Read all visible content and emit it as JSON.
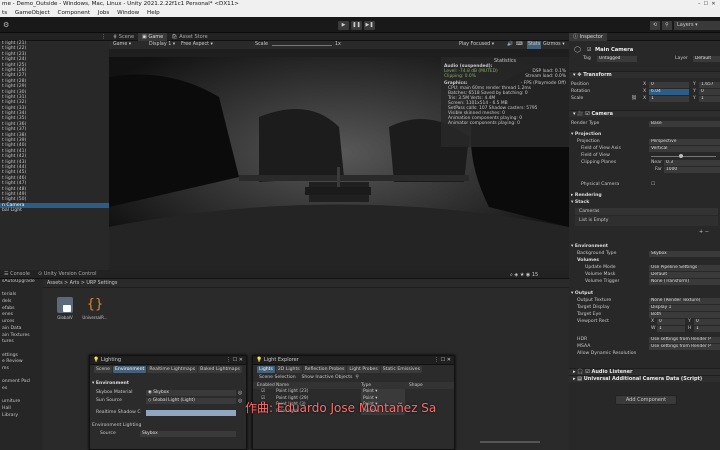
{
  "window": {
    "title": "me - Demo_Outside - Windows, Mac, Linux - Unity 2021.2.22f1c1 Personal* <DX11>"
  },
  "menu": [
    "ts",
    "GameObject",
    "Component",
    "Jobs",
    "Window",
    "Help"
  ],
  "toolbar": {
    "layers": "Layers"
  },
  "hierarchy": {
    "items": [
      "t light (21)",
      "t light (22)",
      "t light (23)",
      "t light (24)",
      "t light (25)",
      "t light (26)",
      "t light (27)",
      "t light (28)",
      "t light (29)",
      "t light (30)",
      "t light (31)",
      "t light (32)",
      "t light (33)",
      "t light (34)",
      "t light (35)",
      "t light (36)",
      "t light (37)",
      "t light (38)",
      "t light (39)",
      "t light (40)",
      "t light (41)",
      "t light (42)",
      "t light (43)",
      "t light (44)",
      "t light (45)",
      "t light (46)",
      "t light (47)",
      "t light (48)",
      "t light (49)",
      "t light (50)",
      "n Camera",
      "bal Light"
    ],
    "selected_index": 30
  },
  "scene_tabs": {
    "scene": "Scene",
    "game": "Game",
    "asset_store": "Asset Store"
  },
  "game_bar": {
    "mode": "Game",
    "display": "Display 1",
    "aspect": "Free Aspect",
    "scale_label": "Scale",
    "scale_value": "1x",
    "play": "Play Focused",
    "stats": "Stats",
    "gizmos": "Gizmos"
  },
  "stats": {
    "title": "Statistics",
    "audio_head": "Audio (suspended):",
    "audio_left": [
      "Level: -74.8 dB (MUTED)",
      "Clipping: 0.0%"
    ],
    "audio_right": [
      "DSP load: 0.1%",
      "Stream load: 0.0%"
    ],
    "graphics_head": "Graphics:",
    "graphics_fps": "- FPS (Playmode Off)",
    "graphics_lines": [
      "CPU: main 60ms  render thread 1.2ms",
      "Batches: 6518      Saved by batching: 0",
      "Tris: 3.5M           Verts: 4.4M",
      "Screen: 1101x514 - 6.5 MB",
      "SetPass calls: 107    Shadow casters: 5795",
      "Visible skinned meshes: 0",
      "Animation components playing: 0",
      "Animator components playing: 0"
    ]
  },
  "inspector": {
    "tab": "Inspector",
    "object_name": "Main Camera",
    "tag_label": "Tag",
    "tag": "Untagged",
    "layer_label": "Layer",
    "layer": "Default",
    "transform_title": "Transform",
    "position_label": "Position",
    "position": {
      "x": "0",
      "y": "1.657"
    },
    "rotation_label": "Rotation",
    "rotation": {
      "x": "6.04",
      "y": "0"
    },
    "scale_label": "Scale",
    "scale": {
      "x": "1",
      "y": "1"
    },
    "camera_title": "Camera",
    "render_type_label": "Render Type",
    "render_type": "Base",
    "projection_head": "Projection",
    "projection_label": "Projection",
    "projection": "Perspective",
    "fov_axis_label": "Field of View Axis",
    "fov_axis": "Vertical",
    "fov_label": "Field of View",
    "clip_label": "Clipping Planes",
    "near_label": "Near",
    "near": "0.3",
    "far_label": "Far",
    "far": "1000",
    "physical_label": "Physical Camera",
    "rendering_head": "Rendering",
    "stack_head": "Stack",
    "cameras_label": "Cameras",
    "list_empty": "List is Empty",
    "env_head": "Environment",
    "bg_type_label": "Background Type",
    "bg_type": "Skybox",
    "volumes_head": "Volumes",
    "update_mode_label": "Update Mode",
    "update_mode": "Use Pipeline Settings",
    "volume_mask_label": "Volume Mask",
    "volume_mask": "Default",
    "volume_trigger_label": "Volume Trigger",
    "volume_trigger": "None (Transform)",
    "output_head": "Output",
    "output_tex_label": "Output Texture",
    "output_tex": "None (Render Texture)",
    "target_display_label": "Target Display",
    "target_display": "Display 1",
    "target_eye_label": "Target Eye",
    "target_eye": "Both",
    "viewport_label": "Viewport Rect",
    "vx": "0",
    "vy": "0",
    "vw": "1",
    "vh": "1",
    "hdr_label": "HDR",
    "hdr": "Use settings from Render P",
    "msaa_label": "MSAA",
    "msaa": "Use settings from Render P",
    "dyn_res_label": "Allow Dynamic Resolution",
    "audio_listener": "Audio Listener",
    "urp_data": "Universal Additional Camera Data (Script)",
    "add_component": "Add Component"
  },
  "project": {
    "tabs": {
      "console": "Console",
      "version": "Unity Version Control"
    },
    "breadcrumb": "Assets > Arts > URP Settings",
    "sidebar": [
      "sAutoUpgrade",
      "",
      "terials",
      "dels",
      "efabs",
      "enes",
      "urces",
      "ain Data",
      "ain Textures",
      "tures",
      "",
      "ettings",
      "e Review",
      "ms",
      "",
      "onment Pacl",
      "es",
      "",
      "urniture",
      "Hall",
      "Library"
    ],
    "assets": [
      "GlobalV",
      "UniversalR..."
    ]
  },
  "lighting": {
    "title": "Lighting",
    "tabs": [
      "Scene",
      "Environment",
      "Realtime Lightmaps",
      "Baked Lightmaps"
    ],
    "env_head": "Environment",
    "skybox_label": "Skybox Material",
    "skybox": "Skybox",
    "sun_label": "Sun Source",
    "sun": "Global Light (Light)",
    "shadow_label": "Realtime Shadow C",
    "env_light_head": "Environment Lighting",
    "source_label": "Source",
    "source": "Skybox"
  },
  "light_explorer": {
    "title": "Light Explorer",
    "tabs": [
      "Lights",
      "2D Lights",
      "Reflection Probes",
      "Light Probes",
      "Static Emissives"
    ],
    "scope": [
      "Scene Selection",
      "Show Inactive Objects"
    ],
    "columns": [
      "Enabled",
      "Name",
      "Type",
      "Shape"
    ],
    "rows": [
      {
        "name": "Point light (23)",
        "type": "Point"
      },
      {
        "name": "Point light (29)",
        "type": "Point"
      },
      {
        "name": "Point light (3)",
        "type": "Point"
      },
      {
        "name": "Point light",
        "type": "Point"
      }
    ]
  },
  "subtitle": "作曲: Eduardo Jose Montañez Sa",
  "colors": {
    "selection": "#2c5d87",
    "tab_active": "#46607a",
    "subtitle": "#ff6b6b"
  }
}
